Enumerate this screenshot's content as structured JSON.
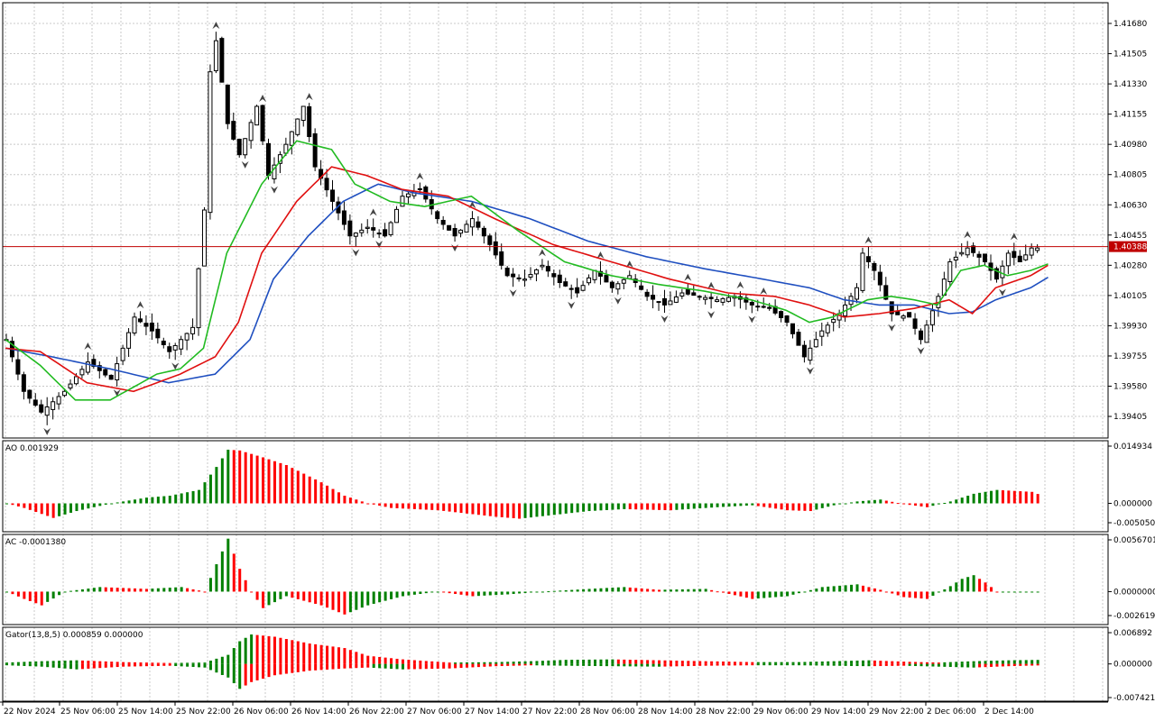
{
  "colors": {
    "background": "#ffffff",
    "grid": "#c8c8c8",
    "frame": "#000000",
    "bull_bar": "#008000",
    "bear_bar": "#ff0000",
    "candle_bull": "#ffffff",
    "candle_bear": "#000000",
    "jaw": "#1f4fc0",
    "teeth": "#e01010",
    "lips": "#22bb22",
    "price_line": "#c00000",
    "price_tag_bg": "#c00000",
    "price_tag_fg": "#ffffff"
  },
  "chart_data": [
    {
      "type": "candlestick",
      "panel": "main",
      "yticks": [
        "1.41680",
        "1.41505",
        "1.41330",
        "1.41155",
        "1.40980",
        "1.40805",
        "1.40630",
        "1.40455",
        "1.40280",
        "1.40105",
        "1.39930",
        "1.39755",
        "1.39580",
        "1.39405"
      ],
      "ylim": [
        1.3928,
        1.418
      ],
      "current_price": "1.40388",
      "anchors": [
        [
          0,
          1.3985
        ],
        [
          3,
          1.3955
        ],
        [
          6,
          1.3943
        ],
        [
          10,
          1.3955
        ],
        [
          14,
          1.3972
        ],
        [
          18,
          1.3962
        ],
        [
          22,
          1.3998
        ],
        [
          25,
          1.399
        ],
        [
          28,
          1.3978
        ],
        [
          30,
          1.3985
        ],
        [
          32,
          1.3992
        ],
        [
          34,
          1.406
        ],
        [
          35,
          1.414
        ],
        [
          36,
          1.4158
        ],
        [
          38,
          1.411
        ],
        [
          40,
          1.4092
        ],
        [
          43,
          1.412
        ],
        [
          45,
          1.408
        ],
        [
          48,
          1.4098
        ],
        [
          51,
          1.412
        ],
        [
          53,
          1.4085
        ],
        [
          56,
          1.4065
        ],
        [
          59,
          1.4045
        ],
        [
          62,
          1.405
        ],
        [
          65,
          1.4045
        ],
        [
          68,
          1.4068
        ],
        [
          71,
          1.4072
        ],
        [
          74,
          1.4055
        ],
        [
          77,
          1.4045
        ],
        [
          80,
          1.4055
        ],
        [
          83,
          1.404
        ],
        [
          86,
          1.4022
        ],
        [
          89,
          1.402
        ],
        [
          92,
          1.4028
        ],
        [
          95,
          1.4018
        ],
        [
          98,
          1.4012
        ],
        [
          101,
          1.4025
        ],
        [
          104,
          1.4015
        ],
        [
          107,
          1.4022
        ],
        [
          110,
          1.401
        ],
        [
          113,
          1.4005
        ],
        [
          116,
          1.4012
        ],
        [
          119,
          1.401
        ],
        [
          122,
          1.4008
        ],
        [
          125,
          1.401
        ],
        [
          128,
          1.4005
        ],
        [
          131,
          1.4003
        ],
        [
          134,
          1.3995
        ],
        [
          137,
          1.3975
        ],
        [
          140,
          1.399
        ],
        [
          143,
          1.4
        ],
        [
          146,
          1.4015
        ],
        [
          147,
          1.4035
        ],
        [
          149,
          1.4025
        ],
        [
          152,
          1.4
        ],
        [
          155,
          1.3998
        ],
        [
          157,
          1.3985
        ],
        [
          160,
          1.401
        ],
        [
          162,
          1.403
        ],
        [
          165,
          1.4038
        ],
        [
          168,
          1.403
        ],
        [
          170,
          1.402
        ],
        [
          172,
          1.4035
        ],
        [
          174,
          1.403
        ],
        [
          176,
          1.4038
        ],
        [
          177,
          1.4038
        ]
      ],
      "alligator": {
        "jaw": [
          [
            0,
            1.398
          ],
          [
            8,
            1.3975
          ],
          [
            18,
            1.3968
          ],
          [
            28,
            1.396
          ],
          [
            36,
            1.3965
          ],
          [
            42,
            1.3985
          ],
          [
            46,
            1.402
          ],
          [
            52,
            1.4045
          ],
          [
            58,
            1.4065
          ],
          [
            64,
            1.4075
          ],
          [
            70,
            1.407
          ],
          [
            80,
            1.4065
          ],
          [
            90,
            1.4055
          ],
          [
            100,
            1.4042
          ],
          [
            110,
            1.4033
          ],
          [
            120,
            1.4026
          ],
          [
            130,
            1.402
          ],
          [
            138,
            1.4015
          ],
          [
            144,
            1.4008
          ],
          [
            150,
            1.4005
          ],
          [
            156,
            1.4005
          ],
          [
            162,
            1.4
          ],
          [
            166,
            1.4001
          ],
          [
            170,
            1.4008
          ],
          [
            176,
            1.4015
          ],
          [
            181,
            1.4025
          ]
        ],
        "teeth": [
          [
            0,
            1.398
          ],
          [
            6,
            1.3978
          ],
          [
            14,
            1.396
          ],
          [
            22,
            1.3955
          ],
          [
            30,
            1.3965
          ],
          [
            36,
            1.3975
          ],
          [
            40,
            1.3995
          ],
          [
            44,
            1.4035
          ],
          [
            50,
            1.4065
          ],
          [
            56,
            1.4085
          ],
          [
            62,
            1.408
          ],
          [
            68,
            1.4072
          ],
          [
            76,
            1.4068
          ],
          [
            84,
            1.4055
          ],
          [
            94,
            1.404
          ],
          [
            104,
            1.403
          ],
          [
            114,
            1.402
          ],
          [
            124,
            1.4012
          ],
          [
            132,
            1.401
          ],
          [
            138,
            1.4005
          ],
          [
            144,
            1.3998
          ],
          [
            150,
            1.4
          ],
          [
            156,
            1.4003
          ],
          [
            162,
            1.4008
          ],
          [
            166,
            1.4
          ],
          [
            170,
            1.4015
          ],
          [
            176,
            1.4022
          ],
          [
            180,
            1.403
          ]
        ],
        "lips": [
          [
            0,
            1.3985
          ],
          [
            6,
            1.397
          ],
          [
            12,
            1.395
          ],
          [
            18,
            1.395
          ],
          [
            26,
            1.3965
          ],
          [
            30,
            1.3968
          ],
          [
            34,
            1.398
          ],
          [
            38,
            1.4035
          ],
          [
            44,
            1.4075
          ],
          [
            50,
            1.41
          ],
          [
            56,
            1.4095
          ],
          [
            60,
            1.4075
          ],
          [
            66,
            1.4065
          ],
          [
            72,
            1.4062
          ],
          [
            80,
            1.4068
          ],
          [
            88,
            1.4048
          ],
          [
            96,
            1.403
          ],
          [
            104,
            1.4022
          ],
          [
            112,
            1.4017
          ],
          [
            120,
            1.4013
          ],
          [
            128,
            1.4008
          ],
          [
            134,
            1.4002
          ],
          [
            138,
            1.3995
          ],
          [
            142,
            1.3998
          ],
          [
            148,
            1.4008
          ],
          [
            152,
            1.401
          ],
          [
            156,
            1.4008
          ],
          [
            160,
            1.4005
          ],
          [
            164,
            1.4025
          ],
          [
            168,
            1.4028
          ],
          [
            172,
            1.4022
          ],
          [
            176,
            1.4025
          ],
          [
            180,
            1.403
          ]
        ]
      }
    },
    {
      "type": "bar",
      "panel": "ao",
      "label": "AO 0.001929",
      "yticks": [
        "0.014934",
        "0.000000",
        "-0.005050"
      ],
      "ylim": [
        -0.00505,
        0.014934
      ],
      "anchors": [
        [
          0,
          0.0
        ],
        [
          3,
          -0.0012
        ],
        [
          8,
          -0.0038
        ],
        [
          12,
          -0.002
        ],
        [
          18,
          0.0
        ],
        [
          24,
          0.0015
        ],
        [
          28,
          0.002
        ],
        [
          33,
          0.0035
        ],
        [
          36,
          0.0095
        ],
        [
          38,
          0.014
        ],
        [
          40,
          0.0138
        ],
        [
          44,
          0.012
        ],
        [
          48,
          0.01
        ],
        [
          54,
          0.0055
        ],
        [
          58,
          0.002
        ],
        [
          62,
          0.0
        ],
        [
          66,
          -0.0012
        ],
        [
          74,
          -0.0018
        ],
        [
          84,
          -0.0035
        ],
        [
          88,
          -0.004
        ],
        [
          94,
          -0.003
        ],
        [
          100,
          -0.002
        ],
        [
          106,
          -0.0015
        ],
        [
          114,
          -0.0018
        ],
        [
          122,
          -0.001
        ],
        [
          128,
          -0.0005
        ],
        [
          134,
          -0.0018
        ],
        [
          138,
          -0.002
        ],
        [
          142,
          -0.0005
        ],
        [
          146,
          0.0005
        ],
        [
          150,
          0.001
        ],
        [
          154,
          -0.0002
        ],
        [
          158,
          -0.001
        ],
        [
          162,
          0.0005
        ],
        [
          166,
          0.0025
        ],
        [
          170,
          0.0035
        ],
        [
          176,
          0.003
        ],
        [
          178,
          0.0019
        ]
      ]
    },
    {
      "type": "bar",
      "panel": "ac",
      "label": "AC -0.0001380",
      "yticks": [
        "0.0056701",
        "0.0000000",
        "-0.0026197"
      ],
      "ylim": [
        -0.0026197,
        0.0056701
      ],
      "anchors": [
        [
          0,
          0.0
        ],
        [
          3,
          -0.0008
        ],
        [
          6,
          -0.0015
        ],
        [
          10,
          0.0
        ],
        [
          16,
          0.0005
        ],
        [
          24,
          0.0003
        ],
        [
          30,
          0.0005
        ],
        [
          34,
          0.0
        ],
        [
          36,
          0.003
        ],
        [
          38,
          0.0058
        ],
        [
          40,
          0.0025
        ],
        [
          42,
          0.0
        ],
        [
          44,
          -0.0018
        ],
        [
          48,
          -0.0005
        ],
        [
          54,
          -0.0015
        ],
        [
          58,
          -0.0025
        ],
        [
          62,
          -0.0015
        ],
        [
          68,
          -0.0005
        ],
        [
          74,
          0.0
        ],
        [
          80,
          -0.0005
        ],
        [
          86,
          -0.0003
        ],
        [
          92,
          0.0
        ],
        [
          100,
          0.0003
        ],
        [
          106,
          0.0005
        ],
        [
          112,
          0.0002
        ],
        [
          120,
          0.0003
        ],
        [
          128,
          -0.0008
        ],
        [
          134,
          -0.0005
        ],
        [
          140,
          0.0005
        ],
        [
          146,
          0.0008
        ],
        [
          150,
          0.0002
        ],
        [
          154,
          -0.0006
        ],
        [
          158,
          -0.0008
        ],
        [
          162,
          0.0006
        ],
        [
          164,
          0.0014
        ],
        [
          166,
          0.0018
        ],
        [
          168,
          0.001
        ],
        [
          170,
          0.0
        ],
        [
          174,
          0.0
        ],
        [
          178,
          0.0
        ]
      ]
    },
    {
      "type": "gator",
      "panel": "gator",
      "label": "Gator(13,8,5) 0.000859 0.000000",
      "yticks": [
        "0.006892",
        "0.000000",
        "-0.007421"
      ],
      "ylim": [
        -0.007421,
        0.006892
      ],
      "upper_anchors": [
        [
          0,
          0.0003
        ],
        [
          6,
          0.0006
        ],
        [
          12,
          0.0008
        ],
        [
          20,
          0.0004
        ],
        [
          28,
          0.0002
        ],
        [
          34,
          0.0003
        ],
        [
          38,
          0.002
        ],
        [
          40,
          0.005
        ],
        [
          42,
          0.0065
        ],
        [
          46,
          0.006
        ],
        [
          52,
          0.0045
        ],
        [
          58,
          0.0035
        ],
        [
          62,
          0.0018
        ],
        [
          68,
          0.001
        ],
        [
          76,
          0.0003
        ],
        [
          84,
          0.0004
        ],
        [
          90,
          0.0006
        ],
        [
          96,
          0.0009
        ],
        [
          104,
          0.001
        ],
        [
          112,
          0.0008
        ],
        [
          120,
          0.0006
        ],
        [
          128,
          0.0004
        ],
        [
          136,
          0.0004
        ],
        [
          142,
          0.0006
        ],
        [
          148,
          0.0008
        ],
        [
          154,
          0.0005
        ],
        [
          160,
          0.0003
        ],
        [
          166,
          0.0006
        ],
        [
          172,
          0.0008
        ],
        [
          178,
          0.0009
        ]
      ],
      "lower_anchors": [
        [
          0,
          -0.0003
        ],
        [
          6,
          -0.0006
        ],
        [
          12,
          -0.0012
        ],
        [
          20,
          -0.0006
        ],
        [
          28,
          -0.0004
        ],
        [
          34,
          -0.0008
        ],
        [
          38,
          -0.003
        ],
        [
          40,
          -0.0055
        ],
        [
          42,
          -0.004
        ],
        [
          46,
          -0.0025
        ],
        [
          52,
          -0.0015
        ],
        [
          58,
          -0.001
        ],
        [
          62,
          -0.0008
        ],
        [
          68,
          -0.0012
        ],
        [
          76,
          -0.001
        ],
        [
          84,
          -0.0005
        ],
        [
          90,
          -0.0003
        ],
        [
          96,
          -0.0004
        ],
        [
          104,
          -0.0005
        ],
        [
          112,
          -0.0006
        ],
        [
          120,
          -0.0004
        ],
        [
          128,
          -0.0003
        ],
        [
          136,
          -0.0003
        ],
        [
          142,
          -0.0004
        ],
        [
          148,
          -0.0005
        ],
        [
          154,
          -0.0004
        ],
        [
          160,
          -0.0006
        ],
        [
          166,
          -0.0008
        ],
        [
          172,
          -0.0005
        ],
        [
          178,
          -0.0003
        ]
      ]
    }
  ],
  "time_axis": [
    "22 Nov 2024",
    "25 Nov 06:00",
    "25 Nov 14:00",
    "25 Nov 22:00",
    "26 Nov 06:00",
    "26 Nov 14:00",
    "26 Nov 22:00",
    "27 Nov 06:00",
    "27 Nov 14:00",
    "27 Nov 22:00",
    "28 Nov 06:00",
    "28 Nov 14:00",
    "28 Nov 22:00",
    "29 Nov 06:00",
    "29 Nov 14:00",
    "29 Nov 22:00",
    "2 Dec 06:00",
    "2 Dec 14:00"
  ]
}
